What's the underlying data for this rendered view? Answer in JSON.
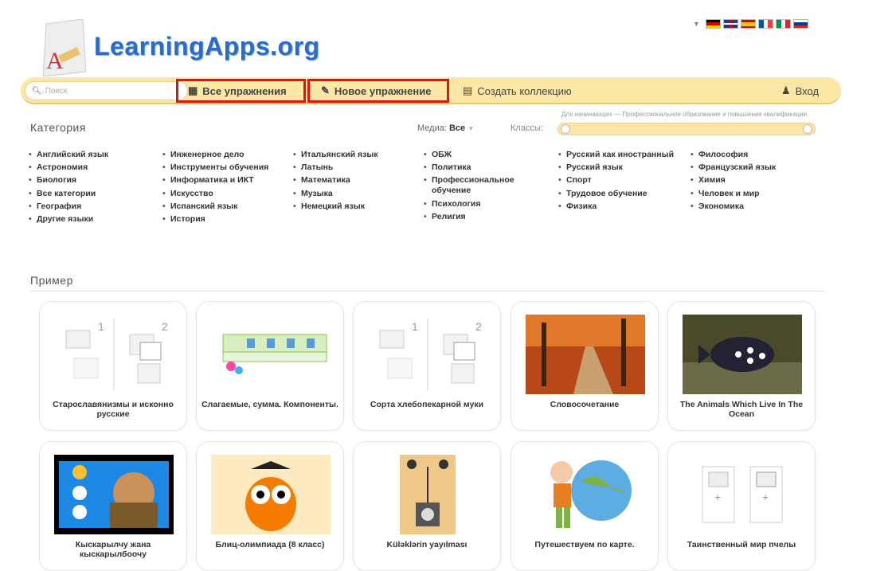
{
  "header": {
    "logo_text": "LearningApps.org"
  },
  "flags": [
    "de-flag",
    "gb-flag",
    "es-flag",
    "fr-flag",
    "it-flag",
    "ru-flag"
  ],
  "toolbar": {
    "search_placeholder": "Поиск",
    "all_exercises": "Все упражнения",
    "new_exercise": "Новое упражнение",
    "create_collection": "Создать коллекцию",
    "login": "Вход"
  },
  "filters": {
    "category_title": "Категория",
    "media_label": "Медиа:",
    "media_value": "Все",
    "classes_label": "Классы:",
    "range_caption": "Для начинающих — Профессиональное образование и повышение квалификации"
  },
  "categories": [
    [
      "Английский язык",
      "Астрономия",
      "Биология",
      "Все категории",
      "География",
      "Другие языки"
    ],
    [
      "Инженерное дело",
      "Инструменты обучения",
      "Информатика и ИКТ",
      "Искусство",
      "Испанский язык",
      "История"
    ],
    [
      "Итальянский язык",
      "Латынь",
      "Математика",
      "Музыка",
      "Немецкий язык"
    ],
    [
      "ОБЖ",
      "Политика",
      "Профессиональное обучение",
      "Психология",
      "Религия"
    ],
    [
      "Русский как иностранный",
      "Русский язык",
      "Спорт",
      "Трудовое обучение",
      "Физика"
    ],
    [
      "Философия",
      "Французский язык",
      "Химия",
      "Человек и мир",
      "Экономика"
    ]
  ],
  "examples_title": "Пример",
  "cards": [
    {
      "title": "Старославянизмы и исконно русские",
      "thumb": "pair-template"
    },
    {
      "title": "Слагаемые, сумма. Компоненты.",
      "thumb": "math-table"
    },
    {
      "title": "Сорта хлебопекарной муки",
      "thumb": "pair-template"
    },
    {
      "title": "Словосочетание",
      "thumb": "autumn-road-photo"
    },
    {
      "title": "The Animals Which Live In The Ocean",
      "thumb": "fish-photo"
    },
    {
      "title": "Кыскарылчу жана кыскарылбоочу",
      "thumb": "video-man"
    },
    {
      "title": "Блиц-олимпиада (8 класс)",
      "thumb": "owl-graduate"
    },
    {
      "title": "Küləklərin yayılması",
      "thumb": "anemometer"
    },
    {
      "title": "Путешествуем по карте.",
      "thumb": "boy-globe"
    },
    {
      "title": "Таинственный мир пчелы",
      "thumb": "add-template"
    }
  ]
}
